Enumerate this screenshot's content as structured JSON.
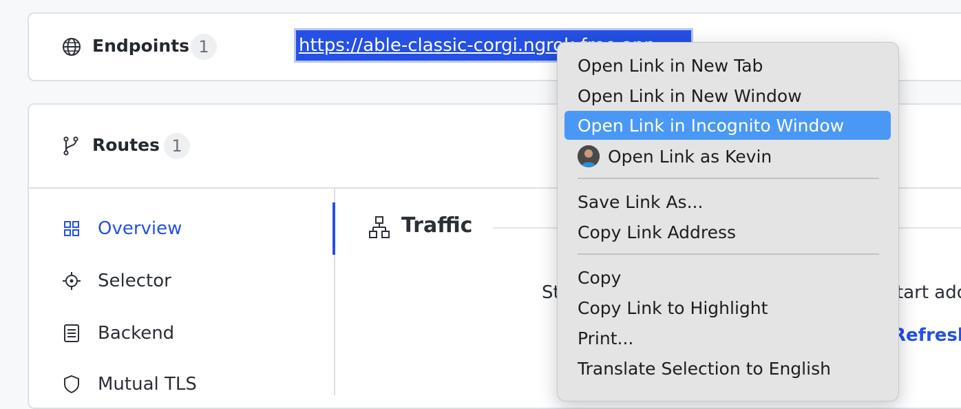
{
  "endpoints": {
    "label": "Endpoints",
    "count": "1",
    "url": "https://able-classic-corgi.ngrok-free.app"
  },
  "routes": {
    "label": "Routes",
    "count": "1",
    "nav": [
      {
        "label": "Overview",
        "icon": "grid-icon",
        "active": true
      },
      {
        "label": "Selector",
        "icon": "crosshair-icon",
        "active": false
      },
      {
        "label": "Backend",
        "icon": "server-icon",
        "active": false
      },
      {
        "label": "Mutual TLS",
        "icon": "shield-icon",
        "active": false
      }
    ]
  },
  "traffic": {
    "title": "Traffic",
    "text_left": "St",
    "text_right": "tart ado",
    "refresh": "Refresh"
  },
  "context_menu": {
    "items": [
      {
        "label": "Open Link in New Tab"
      },
      {
        "label": "Open Link in New Window"
      },
      {
        "label": "Open Link in Incognito Window",
        "highlighted": true
      },
      {
        "label": "Open Link as Kevin"
      },
      {
        "label": "Save Link As..."
      },
      {
        "label": "Copy Link Address"
      },
      {
        "label": "Copy"
      },
      {
        "label": "Copy Link to Highlight"
      },
      {
        "label": "Print..."
      },
      {
        "label": "Translate Selection to English"
      }
    ]
  },
  "colors": {
    "accent": "#2450e5",
    "menu_highlight": "#4a98f6",
    "menu_bg": "#e4e4e4"
  }
}
